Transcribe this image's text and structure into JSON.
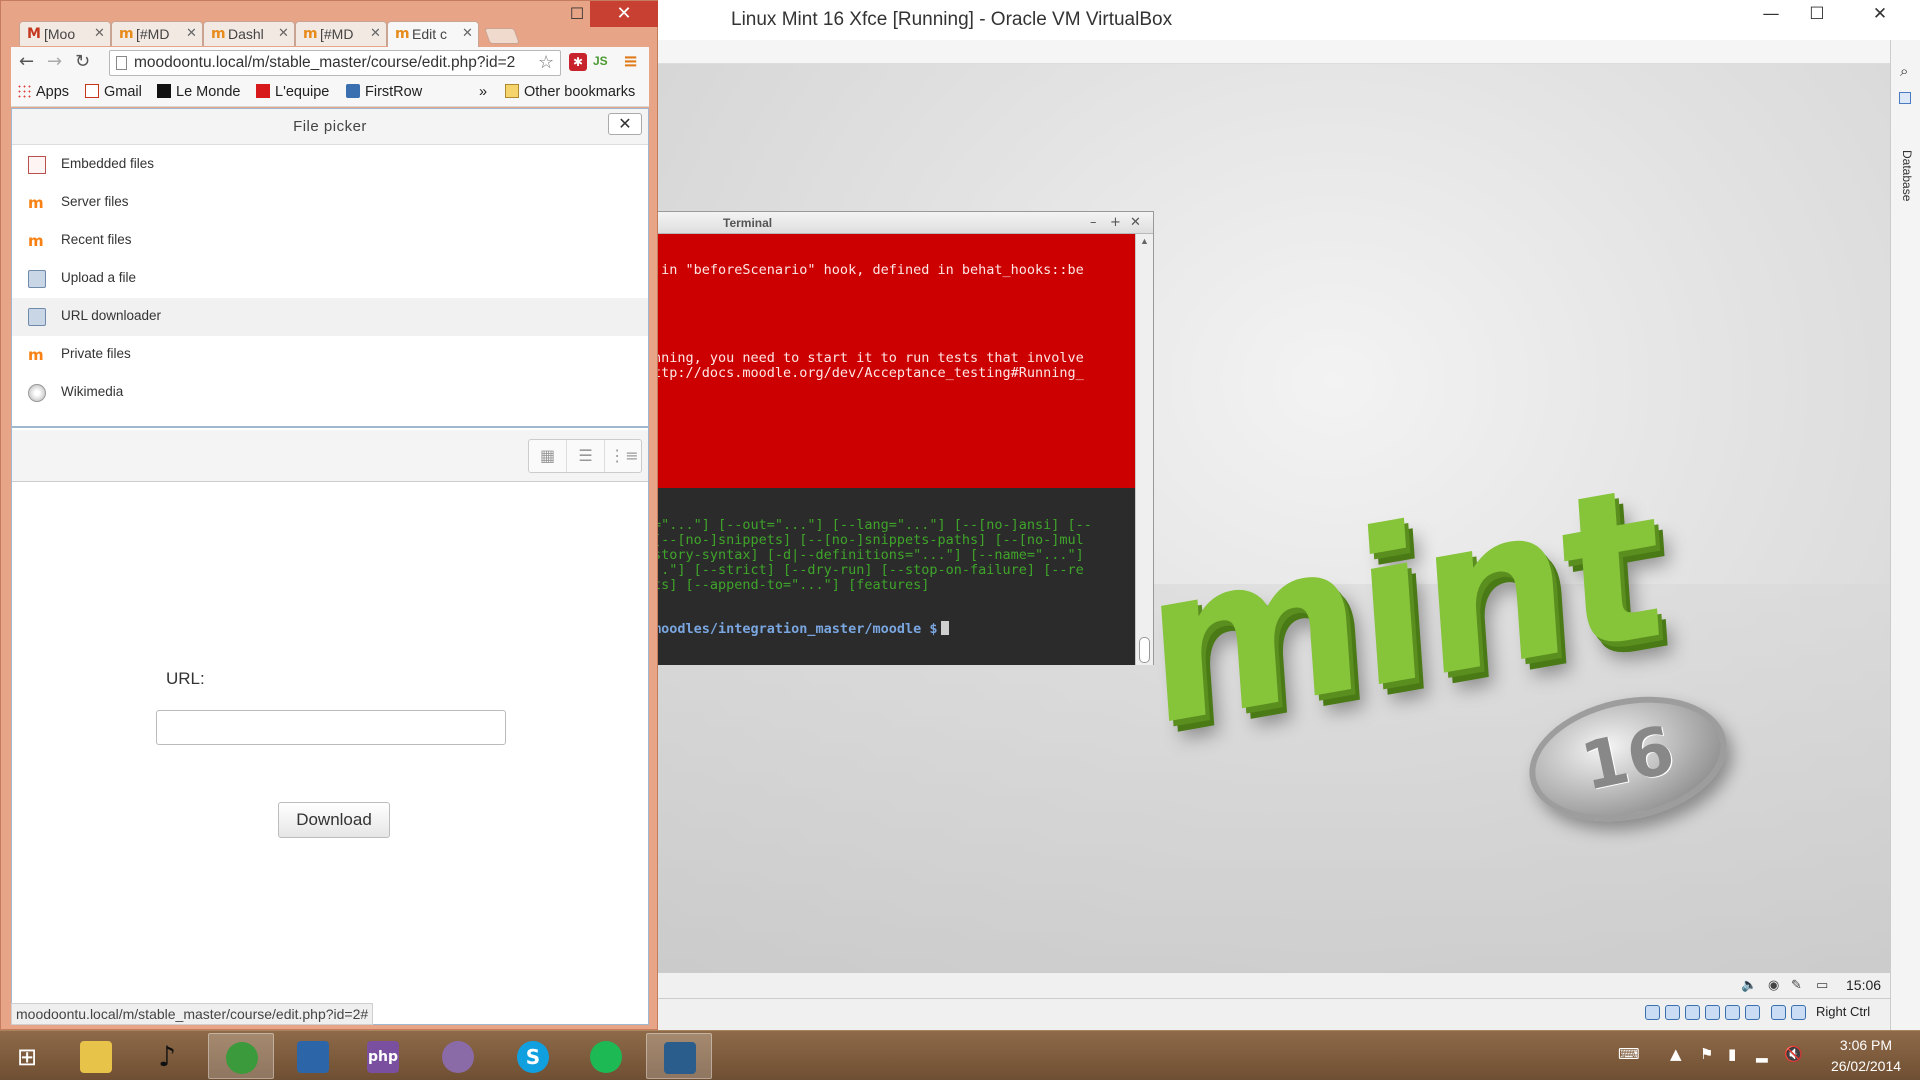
{
  "chrome": {
    "tabs": [
      {
        "label": "[Moo",
        "favicon": "gmail-icon"
      },
      {
        "label": "[#MD",
        "favicon": "moodle-icon"
      },
      {
        "label": "Dashl",
        "favicon": "moodle-icon"
      },
      {
        "label": "[#MD",
        "favicon": "moodle-icon"
      },
      {
        "label": "Edit c",
        "favicon": "moodle-icon",
        "active": true
      }
    ],
    "url": "moodoontu.local/m/stable_master/course/edit.php?id=2",
    "bookmarks": [
      "Apps",
      "Gmail",
      "Le Monde",
      "L'equipe",
      "FirstRow",
      "»",
      "Other bookmarks"
    ],
    "status_url": "moodoontu.local/m/stable_master/course/edit.php?id=2#"
  },
  "file_picker": {
    "title": "File picker",
    "close": "✕",
    "repositories": [
      {
        "label": "Embedded files",
        "icon": "embedded-files-icon"
      },
      {
        "label": "Server files",
        "icon": "moodle-icon"
      },
      {
        "label": "Recent files",
        "icon": "moodle-icon"
      },
      {
        "label": "Upload a file",
        "icon": "upload-icon"
      },
      {
        "label": "URL downloader",
        "icon": "url-downloader-icon",
        "selected": true
      },
      {
        "label": "Private files",
        "icon": "moodle-icon"
      },
      {
        "label": "Wikimedia",
        "icon": "wikimedia-icon"
      }
    ],
    "view_buttons": [
      "icons-view-icon",
      "list-view-icon",
      "tree-view-icon"
    ],
    "url_label": "URL:",
    "url_value": "",
    "download_label": "Download"
  },
  "vbox": {
    "title": "Linux Mint 16 Xfce [Running] - Oracle VM VirtualBox",
    "host_key": "Right Ctrl",
    "side_label": "Database"
  },
  "terminal": {
    "title": "Terminal",
    "error_lines": [
      " in \"beforeScenario\" hook, defined in behat_hooks::be",
      "nning, you need to start it to run tests that involve",
      "ttp://docs.moodle.org/dev/Acceptance_testing#Running_"
    ],
    "usage_lines": [
      "=\"...\"] [--out=\"...\"] [--lang=\"...\"] [--[no-]ansi] [--",
      "[--[no-]snippets] [--[no-]snippets-paths] [--[no-]mul",
      "story-syntax] [-d|--definitions=\"...\"] [--name=\"...\"]",
      "..\"] [--strict] [--dry-run] [--stop-on-failure] [--re",
      "ts] [--append-to=\"...\"] [features]"
    ],
    "prompt": "moodles/integration_master/moodle $"
  },
  "guest_panel": {
    "clock": "15:06"
  },
  "mint_logo": {
    "text": "mint",
    "version": "16"
  },
  "taskbar": {
    "time": "3:06 PM",
    "date": "26/02/2014",
    "apps": [
      {
        "name": "file-explorer-icon",
        "label": "",
        "color": "#e8c34a"
      },
      {
        "name": "music-icon",
        "label": "♪",
        "color": "transparent"
      },
      {
        "name": "chrome-icon",
        "label": "",
        "color": "#3b9a3b",
        "active": true
      },
      {
        "name": "virtualbox-icon",
        "label": "",
        "color": "#2c66a8"
      },
      {
        "name": "phpstorm-icon",
        "label": "php",
        "color": "#7a4fa0"
      },
      {
        "name": "pidgin-icon",
        "label": "",
        "color": "#8b6aa8"
      },
      {
        "name": "skype-icon",
        "label": "S",
        "color": "#10a0e0"
      },
      {
        "name": "spotify-icon",
        "label": "",
        "color": "#1db954"
      },
      {
        "name": "xojo-icon",
        "label": "",
        "color": "#2a5d8c"
      }
    ]
  }
}
